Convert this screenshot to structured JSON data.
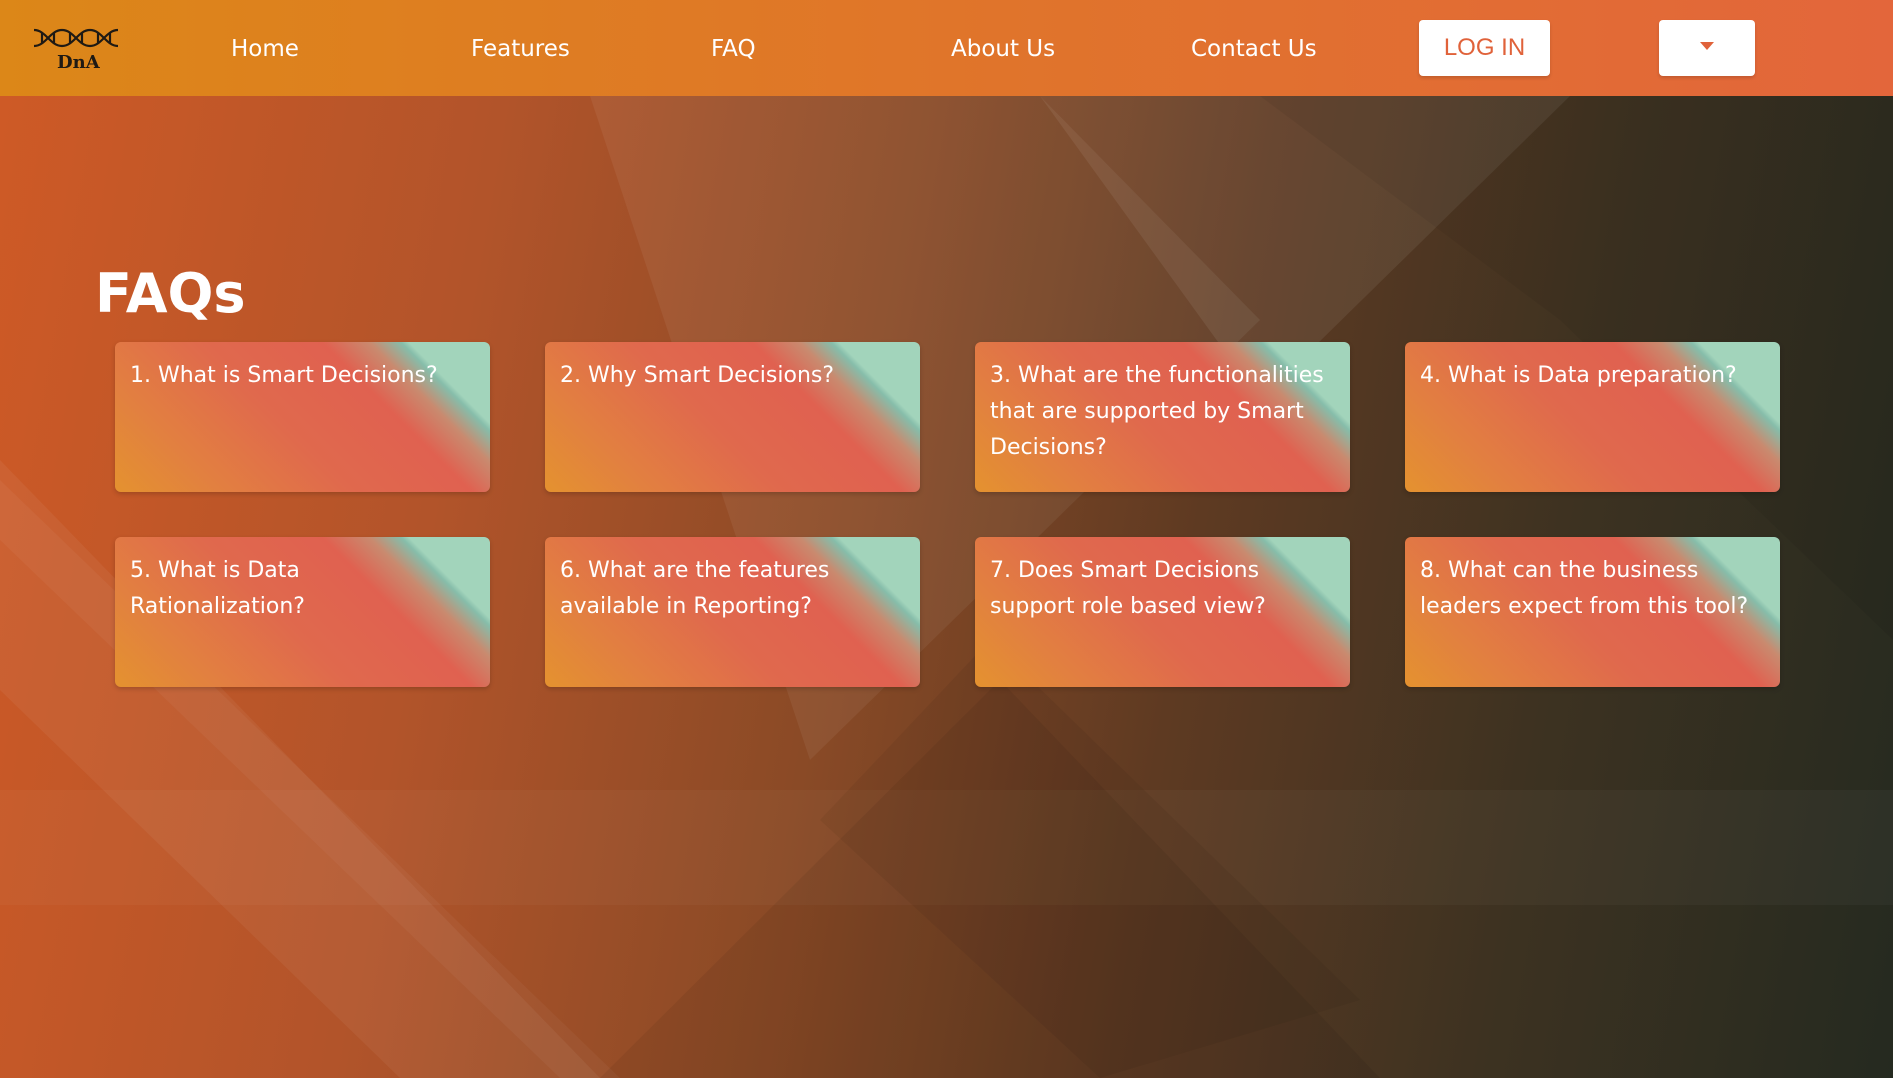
{
  "navbar": {
    "logo_text": "DnA",
    "links": [
      {
        "label": "Home"
      },
      {
        "label": "Features"
      },
      {
        "label": "FAQ"
      },
      {
        "label": "About Us"
      },
      {
        "label": "Contact Us"
      }
    ],
    "login_label": "LOG IN",
    "dropdown_icon": "caret-down-icon"
  },
  "main": {
    "title": "FAQs",
    "faqs": [
      {
        "question": "1. What is Smart Decisions?"
      },
      {
        "question": "2. Why Smart Decisions?"
      },
      {
        "question": "3. What are the functionalities that are supported by Smart Decisions?"
      },
      {
        "question": "4. What is Data preparation?"
      },
      {
        "question": "5. What is Data Rationalization?"
      },
      {
        "question": "6. What are the features available in Reporting?"
      },
      {
        "question": "7. Does Smart Decisions support role based view?"
      },
      {
        "question": "8. What can the business leaders expect from this tool?"
      }
    ]
  },
  "colors": {
    "navbar_start": "#dc8718",
    "navbar_end": "#e3663b",
    "accent": "#e0623a",
    "card_teal": "#a2d4bb"
  }
}
